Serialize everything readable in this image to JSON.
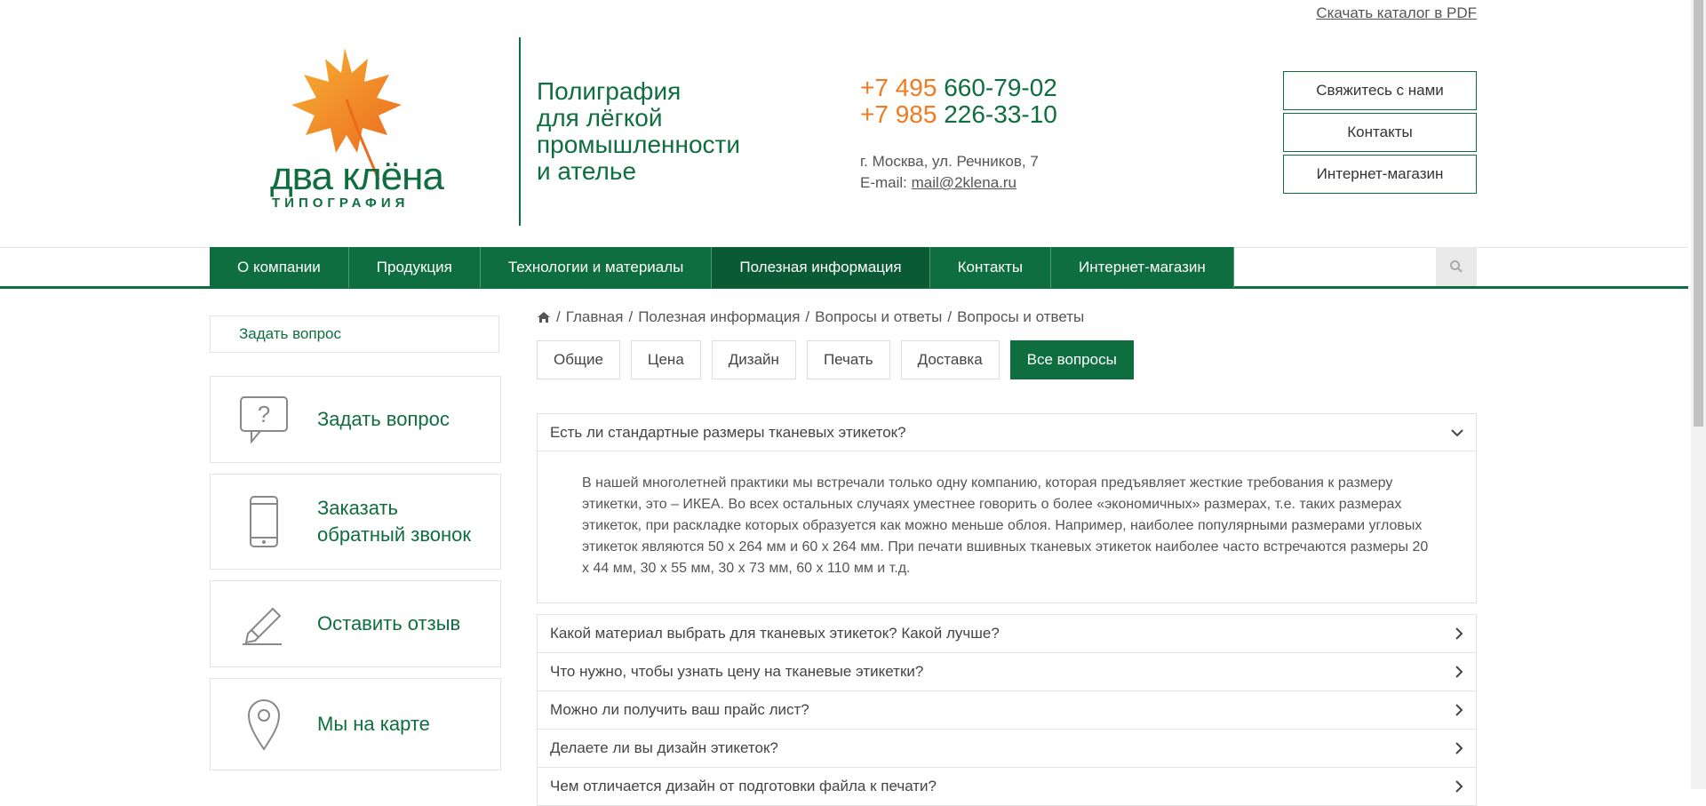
{
  "header": {
    "pdf_link": "Скачать каталог в PDF",
    "logo_name": "два клёна",
    "logo_sub": "ТИПОГРАФИЯ",
    "slogan": [
      "Полиграфия",
      "для лёгкой",
      "промышленности",
      "и ателье"
    ],
    "phones": [
      {
        "code": "+7 495",
        "number": "660-79-02"
      },
      {
        "code": "+7 985",
        "number": "226-33-10"
      }
    ],
    "address": "г. Москва, ул. Речников, 7",
    "email_label": "E-mail:",
    "email": "mail@2klena.ru",
    "buttons": [
      "Свяжитесь с нами",
      "Контакты",
      "Интернет-магазин"
    ]
  },
  "nav": {
    "items": [
      "О компании",
      "Продукция",
      "Технологии и материалы",
      "Полезная информация",
      "Контакты",
      "Интернет-магазин"
    ],
    "active": "Полезная информация",
    "search_icon": "search-icon"
  },
  "sidebar": {
    "top_link": "Задать вопрос",
    "cards": [
      {
        "label": "Задать вопрос",
        "icon": "question-bubble-icon"
      },
      {
        "label": "Заказать обратный звонок",
        "icon": "phone-icon"
      },
      {
        "label": "Оставить отзыв",
        "icon": "pencil-icon"
      },
      {
        "label": "Мы на карте",
        "icon": "map-pin-icon"
      }
    ]
  },
  "breadcrumbs": [
    "Главная",
    "Полезная информация",
    "Вопросы и ответы",
    "Вопросы и ответы"
  ],
  "tabs": [
    "Общие",
    "Цена",
    "Дизайн",
    "Печать",
    "Доставка",
    "Все вопросы"
  ],
  "active_tab": "Все вопросы",
  "faq": {
    "open": {
      "question": "Есть ли стандартные размеры тканевых этикеток?",
      "answer": "В нашей многолетней практики мы встречали только одну компанию, которая предъявляет жесткие требования к размеру этикетки, это – ИКЕА. Во всех остальных случаях уместнее говорить о более «экономичных» размерах, т.е. таких размерах этикеток, при раскладке которых образуется как можно меньше облоя. Например, наиболее популярными размерами угловых этикеток являются 50 х 264 мм и 60 х 264 мм. При печати вшивных тканевых этикеток наиболее часто встречаются размеры 20 х 44 мм, 30 х 55 мм, 30 х 73 мм, 60 х 110 мм и т.д."
    },
    "items": [
      "Какой материал выбрать для тканевых этикеток? Какой лучше?",
      "Что нужно, чтобы узнать цену на тканевые этикетки?",
      "Можно ли получить ваш прайс лист?",
      "Делаете ли вы дизайн этикеток?",
      "Чем отличается дизайн от подготовки файла к печати?"
    ]
  },
  "colors": {
    "brand_green": "#0f6e3f",
    "accent_orange": "#f07a20"
  }
}
